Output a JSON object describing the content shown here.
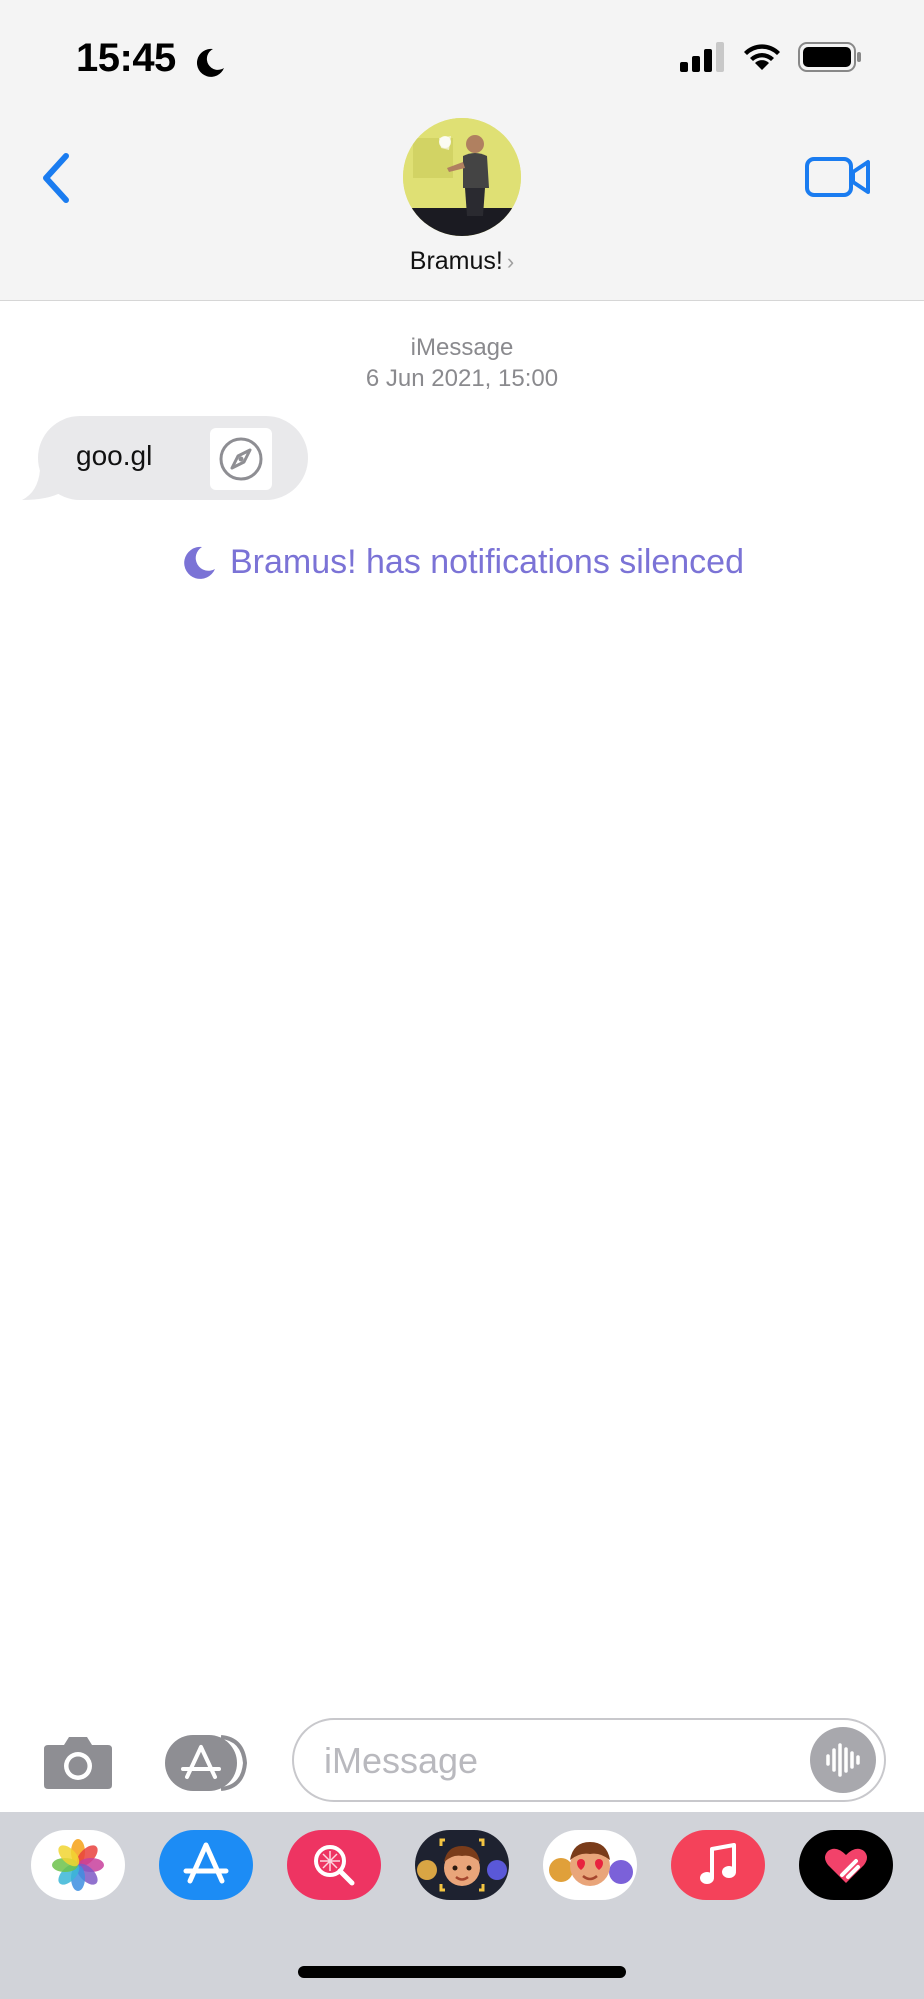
{
  "status_bar": {
    "time": "15:45"
  },
  "header": {
    "contact_name": "Bramus!",
    "chevron": "›"
  },
  "conversation": {
    "service": "iMessage",
    "date": "6 Jun 2021, 15:00",
    "messages": [
      {
        "text": "goo.gl",
        "direction": "received",
        "icon": "compass-icon"
      }
    ],
    "notice": "Bramus! has notifications silenced"
  },
  "input": {
    "placeholder": "iMessage"
  },
  "app_drawer": [
    "Photos",
    "App Store",
    "Search Images",
    "Memoji",
    "Memoji Stickers",
    "Music",
    "Digital Touch"
  ],
  "colors": {
    "accent": "#1a7cf0",
    "bubble": "#e9e9eb",
    "silenced": "#7b73d6",
    "drawer": "#d1d3d9"
  }
}
